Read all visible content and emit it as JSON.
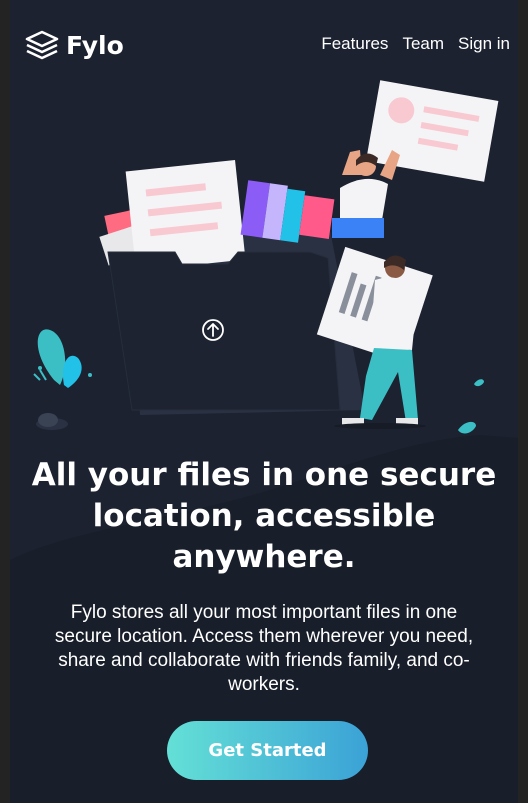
{
  "brand": {
    "name": "Fylo",
    "icon": "layers-icon"
  },
  "nav": [
    {
      "label": "Features"
    },
    {
      "label": "Team"
    },
    {
      "label": "Sign in"
    }
  ],
  "hero": {
    "headline": "All your files in one secure location, accessible anywhere.",
    "description": "Fylo stores all your most important files in one secure location. Access them wherever you need, share and collaborate with friends family, and co-workers.",
    "cta_label": "Get Started"
  },
  "colors": {
    "background": "#1c2230",
    "frame": "#232324",
    "cta_gradient_start": "#64e0d6",
    "cta_gradient_end": "#3ba2d6"
  }
}
